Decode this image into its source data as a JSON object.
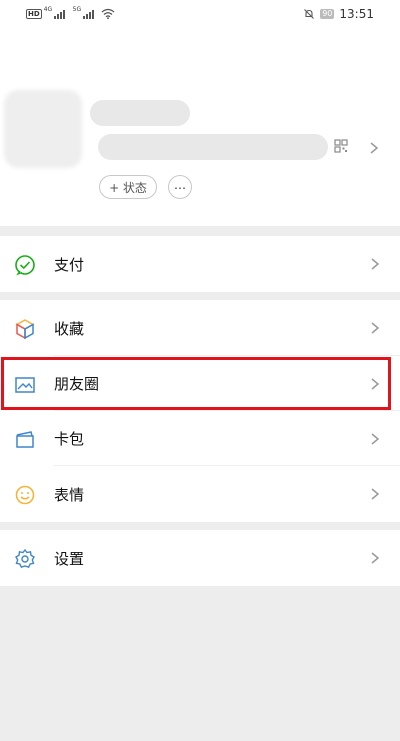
{
  "status_bar": {
    "hd_label": "HD",
    "sig1_gen": "4G",
    "sig2_gen": "5G",
    "battery": "90",
    "time": "13:51",
    "icons": [
      "hd-icon",
      "signal-icon",
      "signal-icon",
      "wifi-icon",
      "mute-icon",
      "battery-icon"
    ]
  },
  "profile": {
    "status_button": "+ 状态",
    "more_button": "…"
  },
  "menu": {
    "pay": "支付",
    "favorites": "收藏",
    "moments": "朋友圈",
    "cards": "卡包",
    "stickers": "表情",
    "settings": "设置"
  },
  "colors": {
    "highlight": "#e0141c",
    "pay_green": "#1aad19",
    "moments_blue": "#3f86c8",
    "settings_blue": "#3f86c8",
    "stickers_yellow": "#f3b53c"
  }
}
